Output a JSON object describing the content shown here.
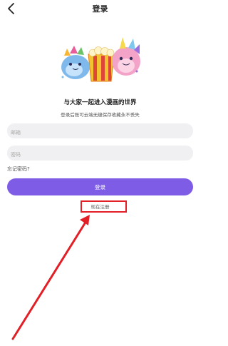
{
  "header": {
    "title": "登录",
    "back_icon": "chevron-left-icon"
  },
  "hero": {
    "illustration": "cartoon-mascots-with-popcorn",
    "slogan": "与大家一起进入漫画的世界",
    "subtitle": "登录后既可云端无缝保存收藏永不丢失"
  },
  "form": {
    "email_placeholder": "邮箱",
    "email_value": "",
    "password_placeholder": "密码",
    "password_value": "",
    "forgot_label": "忘记密码?",
    "login_label": "登录",
    "register_label": "现在注册"
  },
  "annotation": {
    "color": "#e21f26"
  },
  "colors": {
    "accent": "#7e5ce6",
    "field_bg": "#f0f0f2"
  }
}
